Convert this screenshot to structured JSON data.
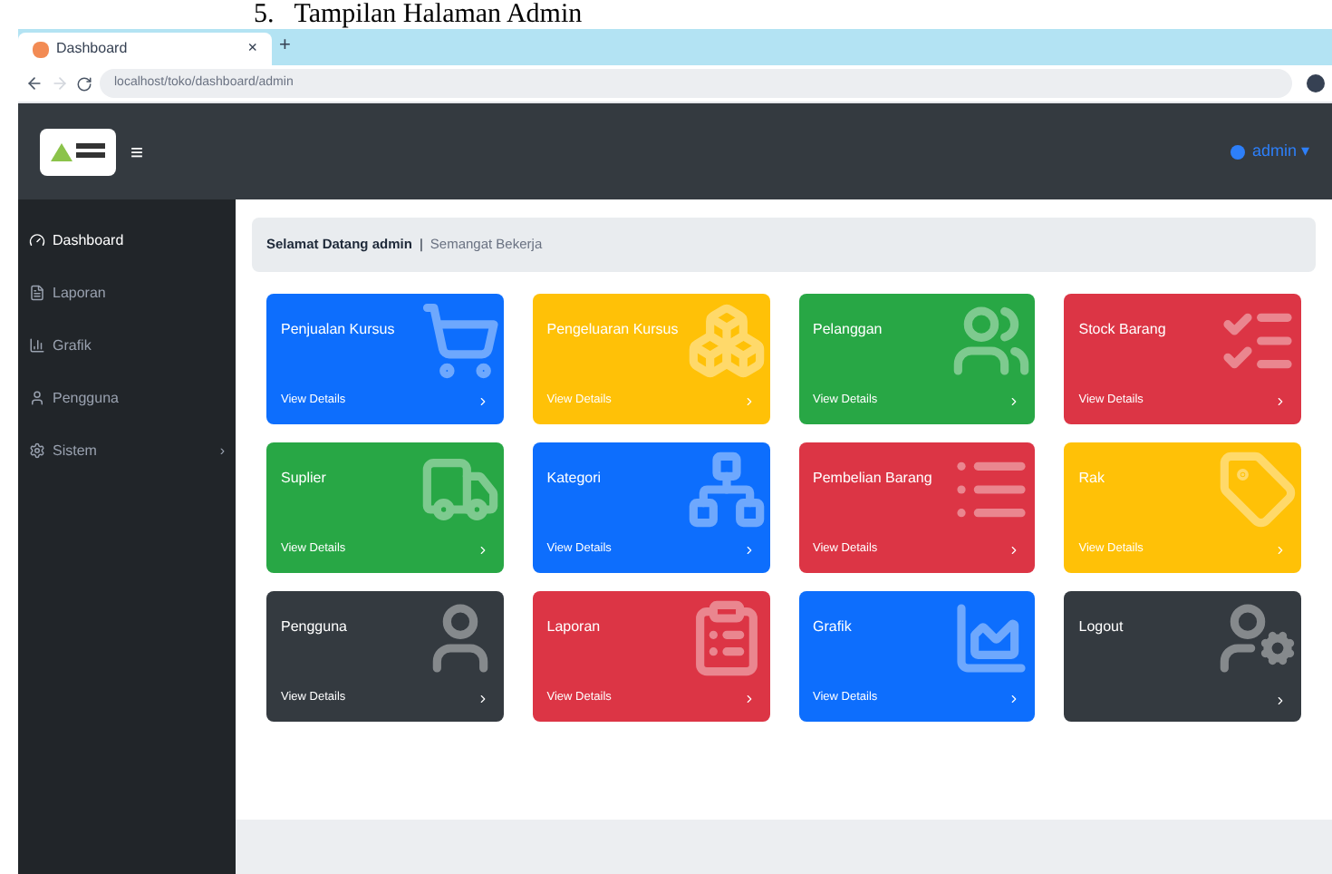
{
  "caption": "5.   Tampilan Halaman Admin",
  "browser": {
    "tab_title": "Dashboard",
    "tab_close": "×",
    "new_tab": "+",
    "address": "localhost/toko/dashboard/admin"
  },
  "navbar": {
    "menu_toggle": "≡",
    "user": "admin ▾"
  },
  "sidebar": {
    "items": [
      {
        "label": "Dashboard",
        "kind": "dashboard",
        "selected": true
      },
      {
        "label": "Laporan",
        "kind": "report",
        "selected": false
      },
      {
        "label": "Grafik",
        "kind": "chart",
        "selected": false
      },
      {
        "label": "Pengguna",
        "kind": "user",
        "selected": false
      },
      {
        "label": "Sistem",
        "kind": "system",
        "selected": false,
        "caret": "›"
      }
    ]
  },
  "welcome": {
    "greeting": "Selamat Datang admin",
    "separator": "|",
    "motto": "Semangat Bekerja"
  },
  "cards": [
    {
      "title": "Penjualan Kursus",
      "link": "View Details",
      "color": "#0d6efd",
      "kind": "cart"
    },
    {
      "title": "Pengeluaran Kursus",
      "link": "View Details",
      "color": "#ffc107",
      "kind": "boxes"
    },
    {
      "title": "Pelanggan",
      "link": "View Details",
      "color": "#28a745",
      "kind": "users"
    },
    {
      "title": "Stock Barang",
      "link": "View Details",
      "color": "#dc3545",
      "kind": "list"
    },
    {
      "title": "Suplier",
      "link": "View Details",
      "color": "#28a745",
      "kind": "truck"
    },
    {
      "title": "Kategori",
      "link": "View Details",
      "color": "#0d6efd",
      "kind": "network"
    },
    {
      "title": "Pembelian Barang",
      "link": "View Details",
      "color": "#dc3545",
      "kind": "rows"
    },
    {
      "title": "Rak",
      "link": "View Details",
      "color": "#ffc107",
      "kind": "tag"
    },
    {
      "title": "Pengguna",
      "link": "View Details",
      "color": "#343a40",
      "kind": "user"
    },
    {
      "title": "Laporan",
      "link": "View Details",
      "color": "#dc3545",
      "kind": "clipboard"
    },
    {
      "title": "Grafik",
      "link": "View Details",
      "color": "#0d6efd",
      "kind": "chart"
    },
    {
      "title": "Logout",
      "color": "#343a40",
      "kind": "usercog"
    }
  ]
}
